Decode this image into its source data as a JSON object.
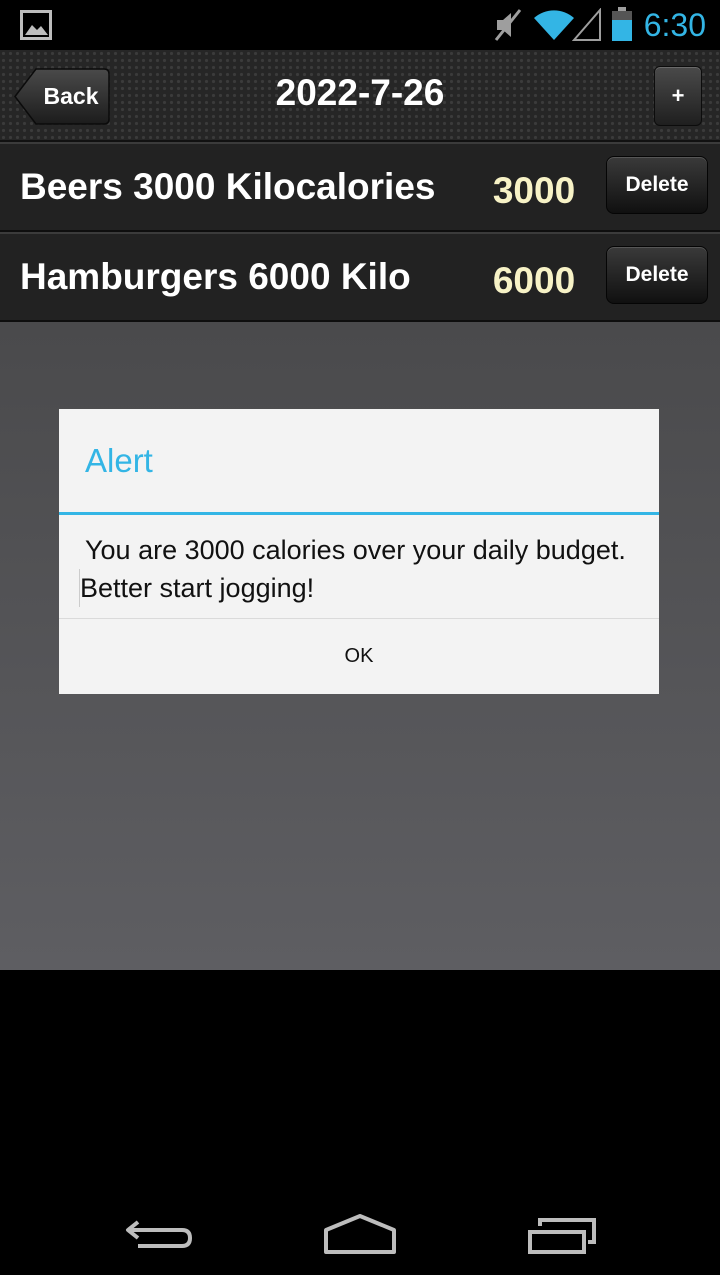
{
  "status_bar": {
    "time": "6:30",
    "icons": [
      "image-notification-icon",
      "mute-icon",
      "wifi-icon",
      "signal-icon",
      "battery-icon"
    ],
    "accent_color": "#33b5e5"
  },
  "header": {
    "back_label": "Back",
    "title": "2022-7-26",
    "add_label": "+"
  },
  "entries": [
    {
      "name": "Beers 3000 Kilocalories",
      "value": "3000",
      "delete_label": "Delete"
    },
    {
      "name": "Hamburgers 6000 Kilo",
      "value": "6000",
      "delete_label": "Delete"
    }
  ],
  "dialog": {
    "title": "Alert",
    "message_line1": "You are 3000 calories over your daily budget.",
    "message_line2": "Better start  jogging!",
    "ok_label": "OK",
    "accent_color": "#33b5e5"
  },
  "nav_bar": {
    "icons": [
      "back-nav-icon",
      "home-nav-icon",
      "recents-nav-icon"
    ]
  }
}
